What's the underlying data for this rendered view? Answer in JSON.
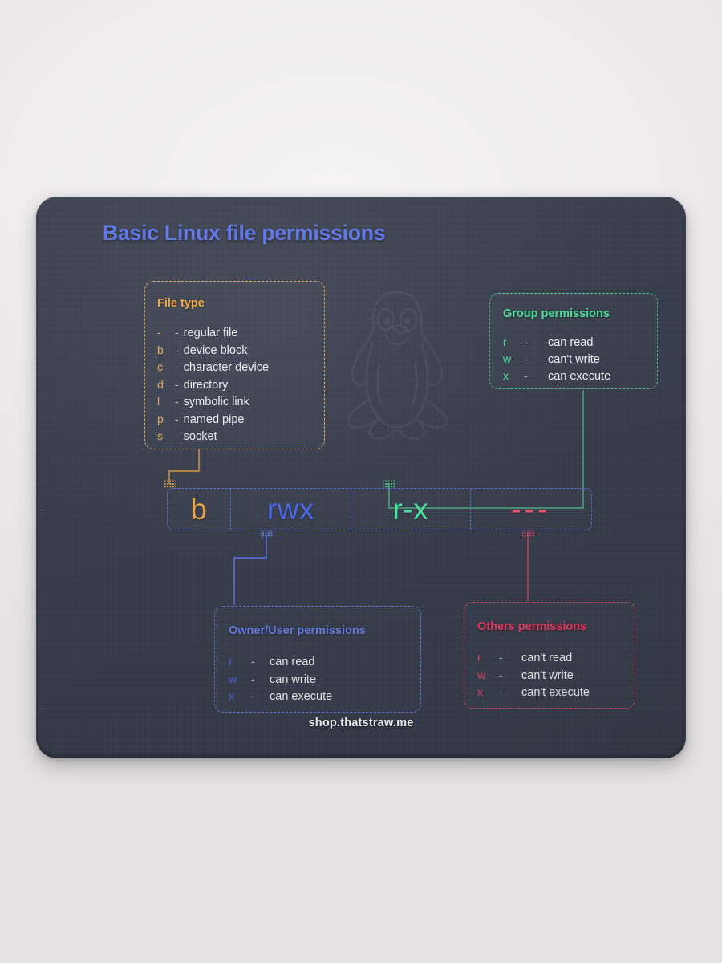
{
  "poster": {
    "title": "Basic Linux file permissions",
    "footer": "shop.thatstraw.me",
    "watermark_icon": "tux-penguin-icon",
    "colors": {
      "title": "#5b72e8",
      "file_type": "#e8a855",
      "owner": "#4d68e0",
      "group": "#4ade9b",
      "others": "#e2486a",
      "pad_background": "#353b4a",
      "page_background": "#eceaea"
    }
  },
  "file_type_card": {
    "title": "File type",
    "rows": [
      {
        "key": "-",
        "dash": "-",
        "value": "regular file"
      },
      {
        "key": "b",
        "dash": "-",
        "value": "device block"
      },
      {
        "key": "c",
        "dash": "-",
        "value": "character device"
      },
      {
        "key": "d",
        "dash": "-",
        "value": "directory"
      },
      {
        "key": "l",
        "dash": "-",
        "value": "symbolic link"
      },
      {
        "key": "p",
        "dash": "-",
        "value": "named pipe"
      },
      {
        "key": "s",
        "dash": "-",
        "value": "socket"
      }
    ]
  },
  "group_card": {
    "title": "Group permissions",
    "rows": [
      {
        "key": "r",
        "dash": "-",
        "value": "can read"
      },
      {
        "key": "w",
        "dash": "-",
        "value": "can't write"
      },
      {
        "key": "x",
        "dash": "-",
        "value": "can execute"
      }
    ]
  },
  "owner_card": {
    "title": "Owner/User permissions",
    "rows": [
      {
        "key": "r",
        "dash": "-",
        "value": "can read"
      },
      {
        "key": "w",
        "dash": "-",
        "value": "can write"
      },
      {
        "key": "x",
        "dash": "-",
        "value": "can execute"
      }
    ]
  },
  "others_card": {
    "title": "Others permissions",
    "rows": [
      {
        "key": "r",
        "dash": "-",
        "value": "can't read"
      },
      {
        "key": "w",
        "dash": "-",
        "value": "can't write"
      },
      {
        "key": "x",
        "dash": "-",
        "value": "can't execute"
      }
    ]
  },
  "permission_string": {
    "full": "brwxr-x---",
    "segments": [
      {
        "name": "file-type",
        "text": "b",
        "color": "#e8a34a"
      },
      {
        "name": "owner",
        "text": "rwx",
        "color": "#4d68f0"
      },
      {
        "name": "group",
        "text": "r-x",
        "color": "#4fe6a2"
      },
      {
        "name": "others",
        "text": "---",
        "color": "#f0556e"
      }
    ]
  }
}
